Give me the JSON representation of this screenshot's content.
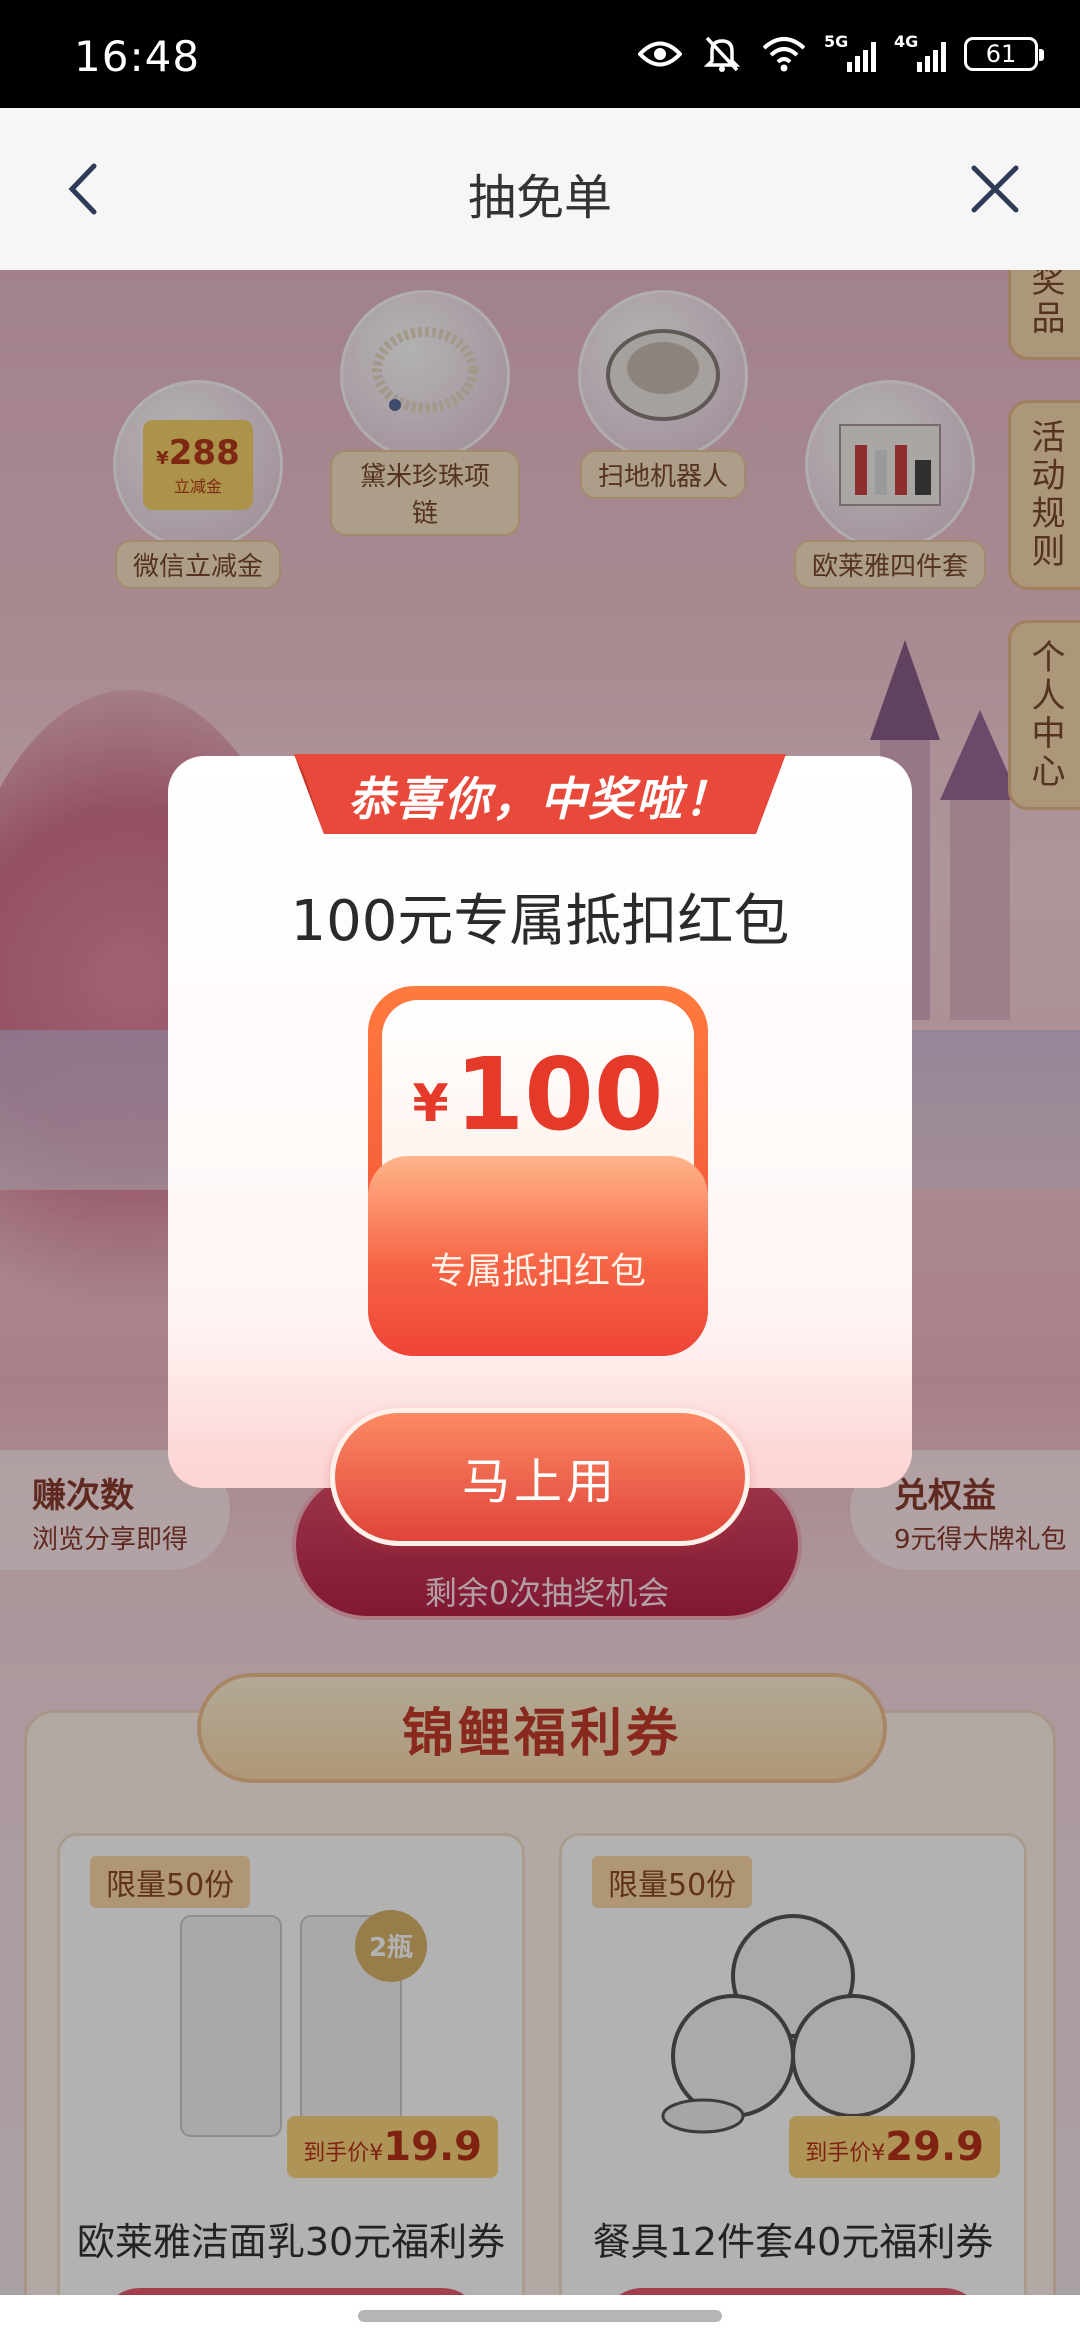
{
  "status_bar": {
    "time": "16:48",
    "sig1_label": "5G",
    "sig2_label": "4G",
    "battery": "61"
  },
  "nav": {
    "title": "抽免单"
  },
  "prizes": [
    {
      "label": "微信立减金",
      "coupon_value": "288",
      "coupon_currency": "¥",
      "coupon_sub": "立减金"
    },
    {
      "label": "黛米珍珠项链"
    },
    {
      "label": "扫地机器人"
    },
    {
      "label": "欧莱雅四件套"
    }
  ],
  "side_tabs": {
    "prize_partial": "奖品",
    "rules": "活动规则",
    "profile": "个人中心"
  },
  "earn": {
    "title": "赚次数",
    "subtitle": "浏览分享即得"
  },
  "redeem": {
    "title": "兑权益",
    "subtitle": "9元得大牌礼包"
  },
  "draw": {
    "remaining_text": "剩余0次抽奖机会"
  },
  "welfare": {
    "title": "锦鲤福利券",
    "cards": [
      {
        "limit": "限量50份",
        "price_prefix": "到手价¥",
        "price": "19.9",
        "name": "欧莱雅洁面乳30元福利券",
        "badge": "2瓶"
      },
      {
        "limit": "限量50份",
        "price_prefix": "到手价¥",
        "price": "29.9",
        "name": "餐具12件套40元福利券"
      }
    ]
  },
  "modal": {
    "ribbon": "恭喜你，中奖啦！",
    "title": "100元专属抵扣红包",
    "currency": "¥",
    "amount": "100",
    "packet_label": "专属抵扣红包",
    "use_button": "马上用"
  }
}
